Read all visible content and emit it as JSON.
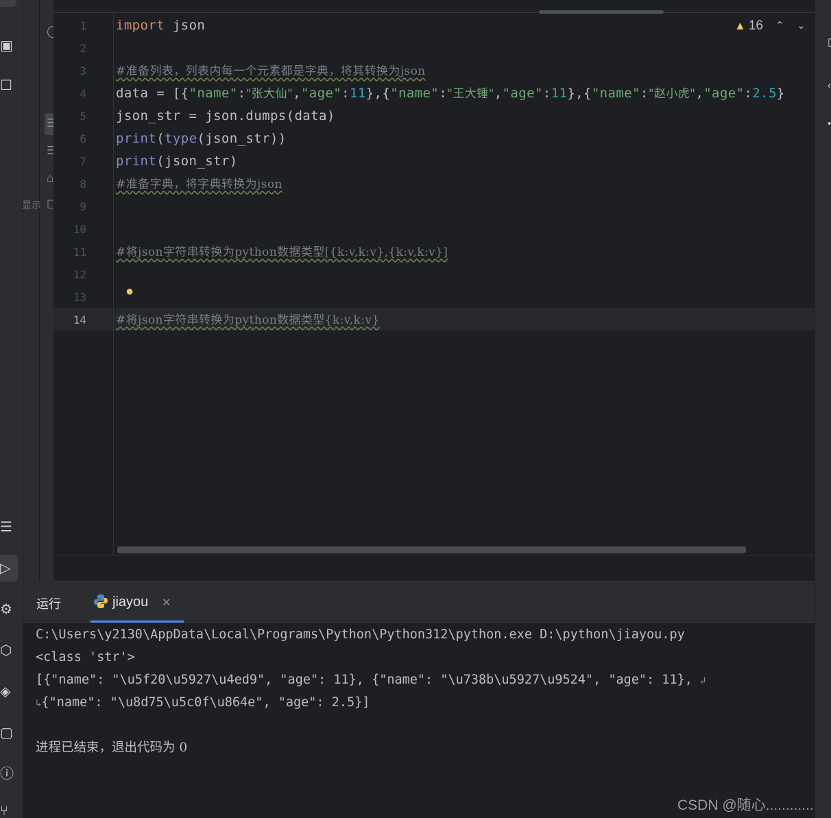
{
  "editor": {
    "line_numbers": [
      "1",
      "2",
      "3",
      "4",
      "5",
      "6",
      "7",
      "8",
      "9",
      "10",
      "11",
      "12",
      "13",
      "14"
    ],
    "current_line": "14",
    "warning_count": "16",
    "code": {
      "l1_kw": "import",
      "l1_rest": " json",
      "l3": "#准备列表，列表内每一个元素都是字典，将其转换为json",
      "l4": [
        [
          "p",
          "data = [{"
        ],
        [
          "s",
          "\"name\""
        ],
        [
          "p",
          ":"
        ],
        [
          "s",
          "\"张大仙\""
        ],
        [
          "p",
          ","
        ],
        [
          "s",
          "\"age\""
        ],
        [
          "p",
          ":"
        ],
        [
          "n",
          "11"
        ],
        [
          "p",
          "},{"
        ],
        [
          "s",
          "\"name\""
        ],
        [
          "p",
          ":"
        ],
        [
          "s",
          "\"王大锤\""
        ],
        [
          "p",
          ","
        ],
        [
          "s",
          "\"age\""
        ],
        [
          "p",
          ":"
        ],
        [
          "n",
          "11"
        ],
        [
          "p",
          "},{"
        ],
        [
          "s",
          "\"name\""
        ],
        [
          "p",
          ":"
        ],
        [
          "s",
          "\"赵小虎\""
        ],
        [
          "p",
          ","
        ],
        [
          "s",
          "\"age\""
        ],
        [
          "p",
          ":"
        ],
        [
          "n",
          "2.5"
        ],
        [
          "p",
          "}"
        ]
      ],
      "l5": "json_str = json.dumps(data)",
      "l6_fn": "print",
      "l6_mid": "(",
      "l6_fn2": "type",
      "l6_rest": "(json_str))",
      "l7_fn": "print",
      "l7_rest": "(json_str)",
      "l8": "#准备字典，将字典转换为json",
      "l11": "#将json字符串转换为python数据类型[{k:v,k:v},{k:v,k:v}]",
      "l14": "#将json字符串转换为python数据类型{k:v,k:v}"
    }
  },
  "run": {
    "title": "运行",
    "tab_label": "jiayou",
    "console": [
      "C:\\Users\\y2130\\AppData\\Local\\Programs\\Python\\Python312\\python.exe D:\\python\\jiayou.py",
      "<class 'str'>",
      "[{\"name\": \"\\u5f20\\u5927\\u4ed9\", \"age\": 11}, {\"name\": \"\\u738b\\u5927\\u9524\", \"age\": 11}, ",
      "{\"name\": \"\\u8d75\\u5c0f\\u864e\", \"age\": 2.5}]",
      "",
      "进程已结束，退出代码为 0"
    ]
  },
  "left_fragment": "显示",
  "watermark": "CSDN @随心............",
  "colors": {
    "background": "#1e1f22",
    "keyword": "#cf8e6d",
    "string": "#6aab73",
    "number": "#2aacb8",
    "builtin": "#8888c6",
    "comment": "#7a7e85",
    "warning": "#f2c55c",
    "accent": "#548af7"
  },
  "icons": [
    "structure-icon",
    "bookmarks-icon",
    "list-icon",
    "run-icon",
    "python-console-icon",
    "layers-icon",
    "services-icon",
    "terminal-icon",
    "problems-icon",
    "git-icon",
    "warning-icon",
    "chevron-up-icon",
    "chevron-down-icon",
    "lightbulb-icon",
    "python-file-icon",
    "close-icon",
    "database-icon"
  ]
}
